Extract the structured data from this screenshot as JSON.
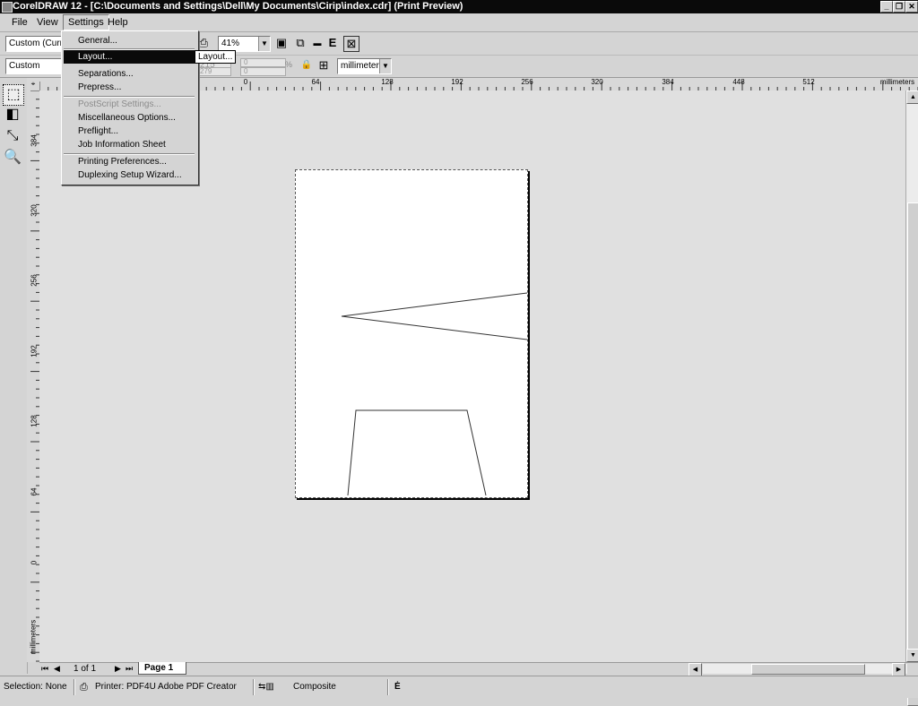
{
  "title_bar": {
    "title": "CorelDRAW 12 - [C:\\Documents and Settings\\Dell\\My Documents\\Cirip\\index.cdr] (Print Preview)"
  },
  "menu": {
    "items": [
      "File",
      "View",
      "Settings",
      "Help"
    ]
  },
  "settings_menu": {
    "items": [
      {
        "label": "General...",
        "state": "normal"
      },
      {
        "label": "Layout...",
        "state": "highlighted"
      },
      {
        "label": "Separations...",
        "state": "normal"
      },
      {
        "label": "Prepress...",
        "state": "normal"
      },
      {
        "label": "PostScript Settings...",
        "state": "disabled"
      },
      {
        "label": "Miscellaneous Options...",
        "state": "normal"
      },
      {
        "label": "Preflight...",
        "state": "normal"
      },
      {
        "label": "Job Information Sheet",
        "state": "normal"
      },
      {
        "label": "Printing Preferences...",
        "state": "normal"
      },
      {
        "label": "Duplexing Setup Wizard...",
        "state": "normal"
      }
    ],
    "tooltip": "Layout..."
  },
  "toolbar1": {
    "style_combo": "Custom (Curren",
    "zoom_value": "41%"
  },
  "toolbar2": {
    "preset_combo": "Custom",
    "pos_x": "0",
    "pos_y": "0",
    "width_val": "215",
    "height_val": "279",
    "percent_symbol": "%",
    "units": "millimeters"
  },
  "rulers": {
    "h_labels": [
      "0",
      "64",
      "128",
      "192",
      "256",
      "320",
      "384",
      "448",
      "512",
      "millimeters"
    ],
    "v_labels": [
      "384",
      "320",
      "256",
      "192",
      "128",
      "64",
      "0",
      "millimeters"
    ],
    "corner_icon": "ruler-corner-icon"
  },
  "page_nav": {
    "page_count": "1 of 1",
    "page_tab": "Page 1"
  },
  "status_bar": {
    "selection": "Selection: None",
    "printer": "Printer: PDF4U Adobe PDF Creator",
    "mode": "Composite"
  },
  "icons": {
    "toolbox": [
      "pick-tool-icon",
      "imposition-layout-icon",
      "marks-placement-icon",
      "zoom-icon"
    ],
    "toolbar": [
      "print-icon",
      "full-screen-icon",
      "separations-icon",
      "invert-icon",
      "emulsion-down-icon",
      "close-preview-icon"
    ]
  }
}
